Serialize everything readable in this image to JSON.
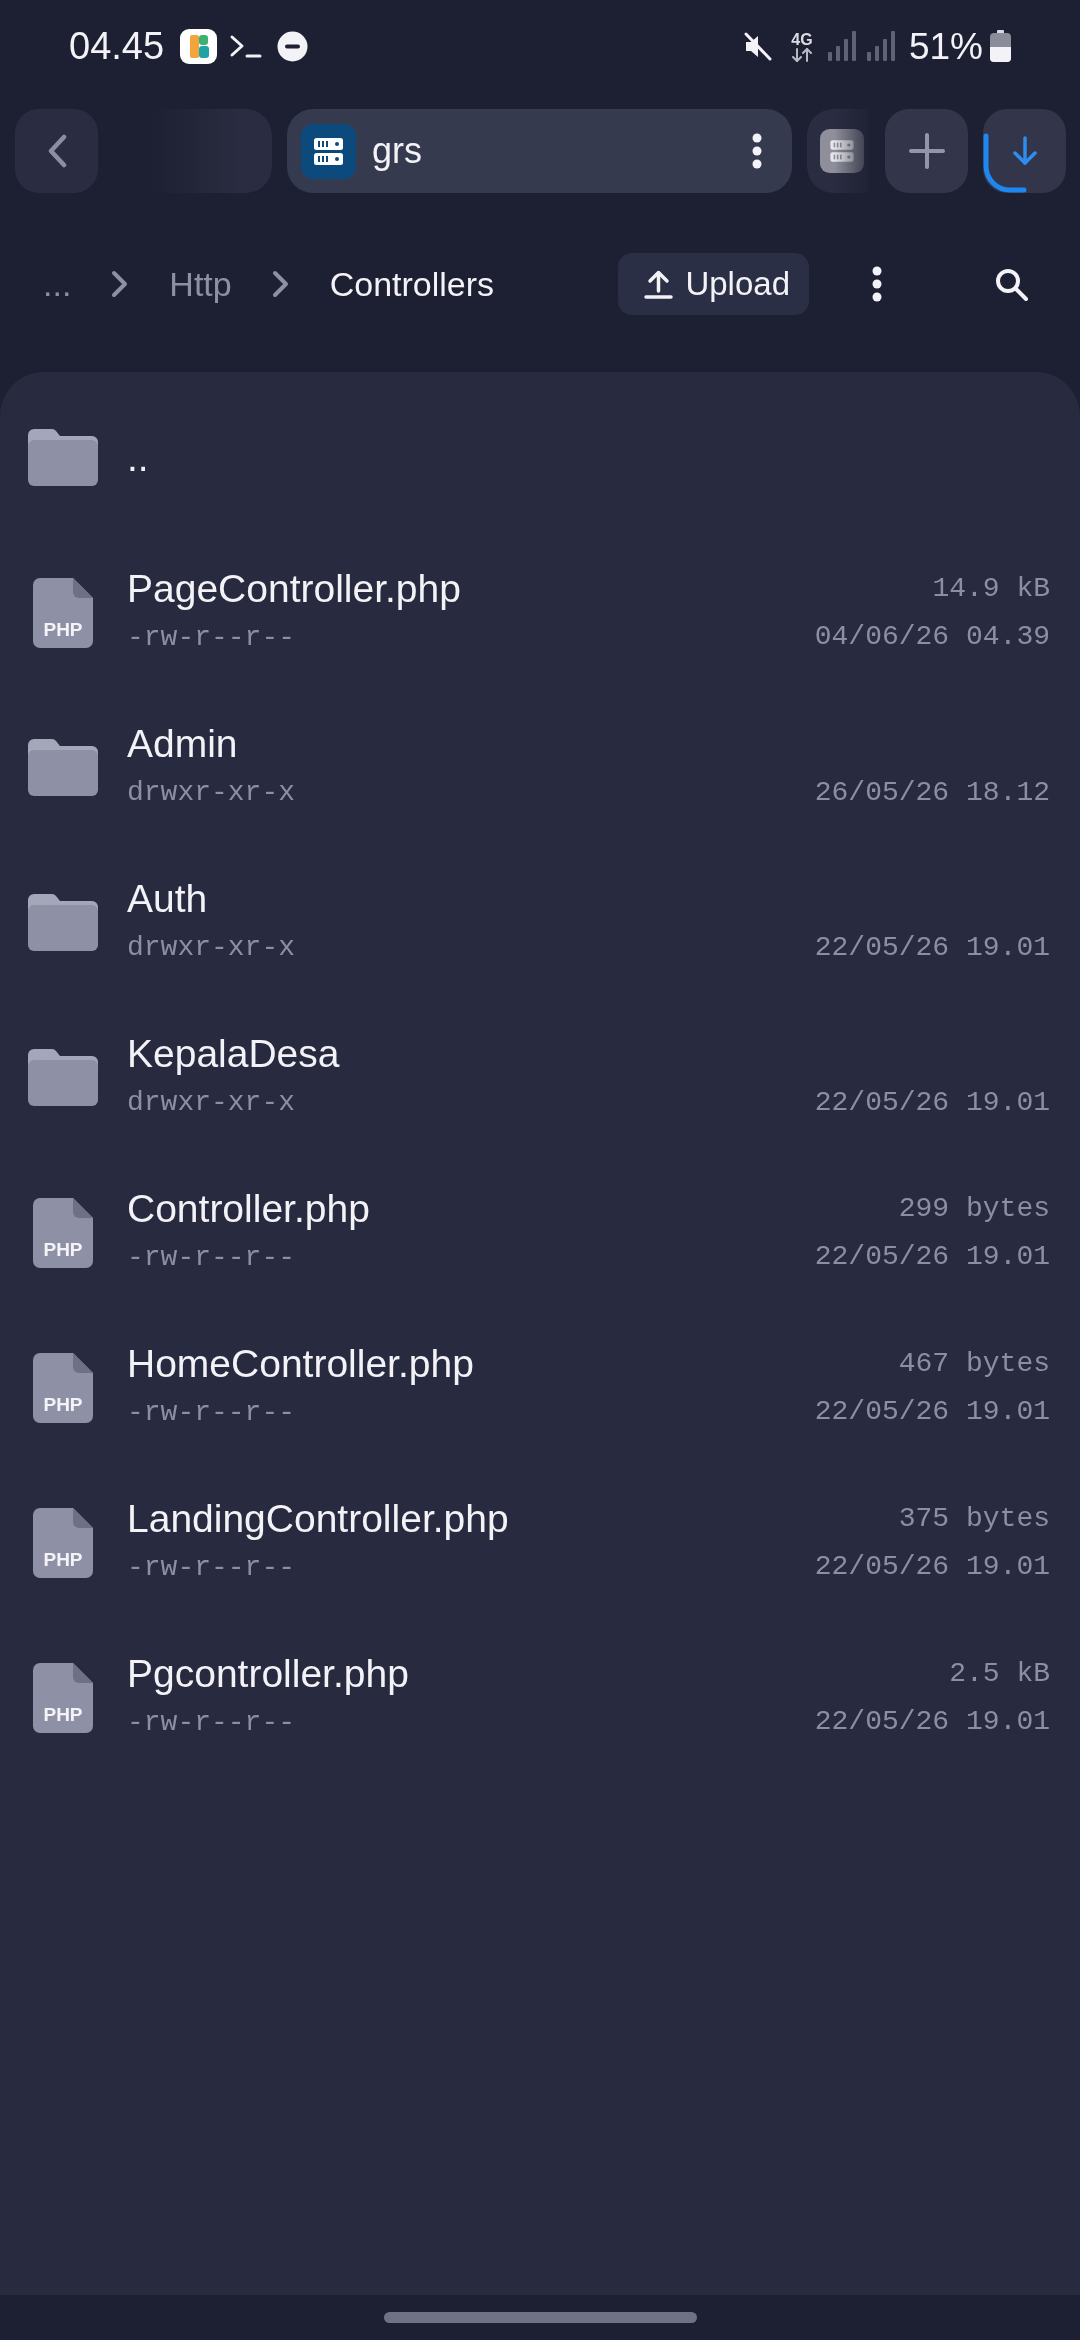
{
  "status_bar": {
    "time": "04.45",
    "network_type": "4G",
    "battery_text": "51%"
  },
  "tab_bar": {
    "tabs": [
      {
        "kind": "blank",
        "selected": false
      },
      {
        "kind": "server",
        "label": "grs",
        "selected": true
      },
      {
        "kind": "server",
        "selected": false
      }
    ]
  },
  "breadcrumbs": [
    {
      "label": "...",
      "selected": false
    },
    {
      "label": "Http",
      "selected": false
    },
    {
      "label": "Controllers",
      "selected": true
    }
  ],
  "toolbar": {
    "upload_label": "Upload"
  },
  "files": [
    {
      "kind": "folder",
      "name": ".."
    },
    {
      "kind": "file",
      "name": "PageController.php",
      "type_label": "PHP",
      "size": "14.9 kB",
      "permissions": "-rw-r--r--",
      "modified": "04/06/26 04.39"
    },
    {
      "kind": "folder",
      "name": "Admin",
      "permissions": "drwxr-xr-x",
      "modified": "26/05/26 18.12"
    },
    {
      "kind": "folder",
      "name": "Auth",
      "permissions": "drwxr-xr-x",
      "modified": "22/05/26 19.01"
    },
    {
      "kind": "folder",
      "name": "KepalaDesa",
      "permissions": "drwxr-xr-x",
      "modified": "22/05/26 19.01"
    },
    {
      "kind": "file",
      "name": "Controller.php",
      "type_label": "PHP",
      "size": "299 bytes",
      "permissions": "-rw-r--r--",
      "modified": "22/05/26 19.01"
    },
    {
      "kind": "file",
      "name": "HomeController.php",
      "type_label": "PHP",
      "size": "467 bytes",
      "permissions": "-rw-r--r--",
      "modified": "22/05/26 19.01"
    },
    {
      "kind": "file",
      "name": "LandingController.php",
      "type_label": "PHP",
      "size": "375 bytes",
      "permissions": "-rw-r--r--",
      "modified": "22/05/26 19.01"
    },
    {
      "kind": "file",
      "name": "Pgcontroller.php",
      "type_label": "PHP",
      "size": "2.5 kB",
      "permissions": "-rw-r--r--",
      "modified": "22/05/26 19.01"
    }
  ]
}
